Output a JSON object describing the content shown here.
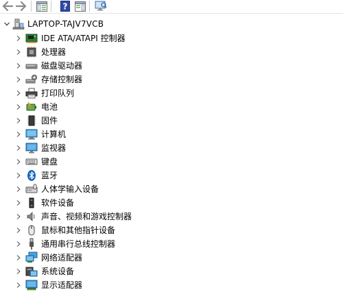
{
  "toolbar": {
    "buttons": [
      {
        "name": "back-button",
        "icon": "back-arrow-icon"
      },
      {
        "name": "forward-button",
        "icon": "forward-arrow-icon"
      },
      {
        "name": "show-hide-console-tree-button",
        "icon": "console-tree-icon"
      },
      {
        "name": "help-button",
        "icon": "help-icon"
      },
      {
        "name": "action-pane-button",
        "icon": "action-pane-icon"
      },
      {
        "name": "scan-hardware-button",
        "icon": "monitor-scan-icon"
      }
    ]
  },
  "tree": {
    "root": {
      "label": "LAPTOP-TAJV7VCB",
      "icon": "computer-icon",
      "expanded": true
    },
    "items": [
      {
        "label": "IDE ATA/ATAPI 控制器",
        "icon": "ide-controller-icon"
      },
      {
        "label": "处理器",
        "icon": "processor-icon"
      },
      {
        "label": "磁盘驱动器",
        "icon": "disk-drive-icon"
      },
      {
        "label": "存储控制器",
        "icon": "storage-controller-icon"
      },
      {
        "label": "打印队列",
        "icon": "printer-icon"
      },
      {
        "label": "电池",
        "icon": "battery-icon"
      },
      {
        "label": "固件",
        "icon": "firmware-icon"
      },
      {
        "label": "计算机",
        "icon": "computer-monitor-icon"
      },
      {
        "label": "监视器",
        "icon": "monitor-icon"
      },
      {
        "label": "键盘",
        "icon": "keyboard-icon"
      },
      {
        "label": "蓝牙",
        "icon": "bluetooth-icon"
      },
      {
        "label": "人体学输入设备",
        "icon": "hid-icon"
      },
      {
        "label": "软件设备",
        "icon": "software-device-icon"
      },
      {
        "label": "声音、视频和游戏控制器",
        "icon": "speaker-icon"
      },
      {
        "label": "鼠标和其他指针设备",
        "icon": "mouse-icon"
      },
      {
        "label": "通用串行总线控制器",
        "icon": "usb-icon"
      },
      {
        "label": "网络适配器",
        "icon": "network-adapter-icon"
      },
      {
        "label": "系统设备",
        "icon": "system-device-icon"
      },
      {
        "label": "显示适配器",
        "icon": "display-adapter-icon"
      }
    ]
  }
}
